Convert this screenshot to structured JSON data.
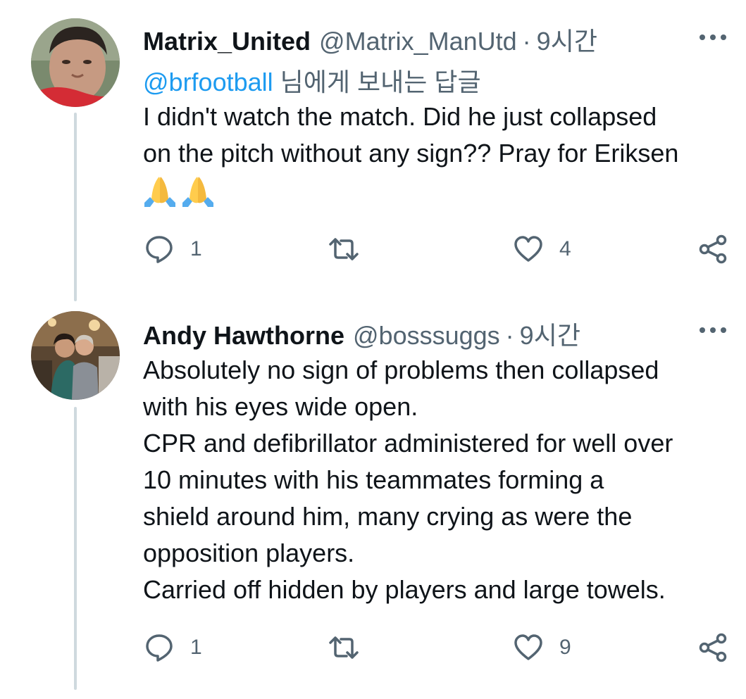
{
  "tweets": [
    {
      "display_name": "Matrix_United",
      "handle": "@Matrix_ManUtd",
      "separator": "·",
      "time": "9시간",
      "reply_mention": "@brfootball",
      "reply_suffix": " 님에게 보내는 답글",
      "body_lines": [
        "I didn't watch the match. Did he just collapsed",
        "on the pitch without any sign??  Pray for Eriksen"
      ],
      "emojis": [
        "folded-hands",
        "folded-hands"
      ],
      "reply_count": "1",
      "retweet_count": "",
      "like_count": "4"
    },
    {
      "display_name": "Andy Hawthorne",
      "handle": "@bosssuggs",
      "separator": "·",
      "time": "9시간",
      "body_lines": [
        "Absolutely no sign of problems then collapsed",
        "with his eyes wide open.",
        "CPR and defibrillator administered for well over",
        "10 minutes with his teammates forming a",
        "shield around him, many crying as were the",
        "opposition players.",
        "Carried off hidden by players and large towels."
      ],
      "reply_count": "1",
      "retweet_count": "",
      "like_count": "9"
    }
  ],
  "icons": {
    "reply": "reply-icon",
    "retweet": "retweet-icon",
    "like": "heart-icon",
    "share": "share-icon",
    "more": "more-icon"
  },
  "colors": {
    "link": "#1d9bf0",
    "muted": "#536471",
    "thread_line": "#cfd9de"
  }
}
